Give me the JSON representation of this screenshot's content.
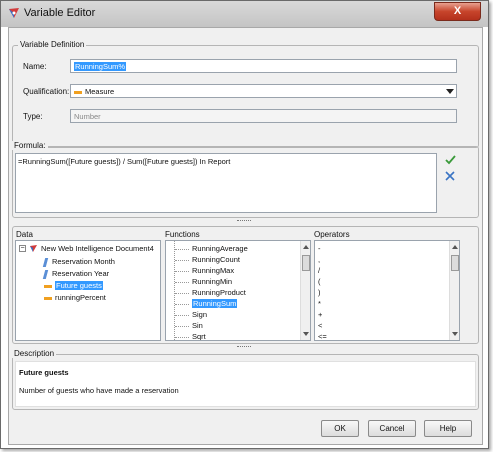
{
  "window": {
    "title": "Variable Editor",
    "close_label": "X"
  },
  "definition": {
    "legend": "Variable Definition",
    "name_label": "Name:",
    "name_value": "RunningSum%",
    "qualification_label": "Qualification:",
    "qualification_value": "Measure",
    "type_label": "Type:",
    "type_value": "Number"
  },
  "formula": {
    "legend": "Formula:",
    "text": "=RunningSum([Future guests]) / Sum([Future guests]) In Report",
    "validate_icon": "check-icon",
    "cancel_icon": "x-icon"
  },
  "data": {
    "legend": "Data",
    "root": "New Web Intelligence Document4",
    "items": [
      {
        "label": "Reservation Month",
        "icon": "dimension-icon",
        "selected": false
      },
      {
        "label": "Reservation Year",
        "icon": "dimension-icon",
        "selected": false
      },
      {
        "label": "Future guests",
        "icon": "measure-icon",
        "selected": true
      },
      {
        "label": "runningPercent",
        "icon": "measure-icon",
        "selected": false
      }
    ]
  },
  "functions": {
    "legend": "Functions",
    "items": [
      "RunningAverage",
      "RunningCount",
      "RunningMax",
      "RunningMin",
      "RunningProduct",
      "RunningSum",
      "Sign",
      "Sin",
      "Sqrt"
    ],
    "selected": "RunningSum"
  },
  "operators": {
    "legend": "Operators",
    "items": [
      "-",
      ",",
      "/",
      "(",
      ")",
      "*",
      "+",
      "<",
      "<="
    ]
  },
  "description": {
    "legend": "Description",
    "title": "Future guests",
    "text": "Number of guests who have made a reservation"
  },
  "buttons": {
    "ok": "OK",
    "cancel": "Cancel",
    "help": "Help"
  }
}
